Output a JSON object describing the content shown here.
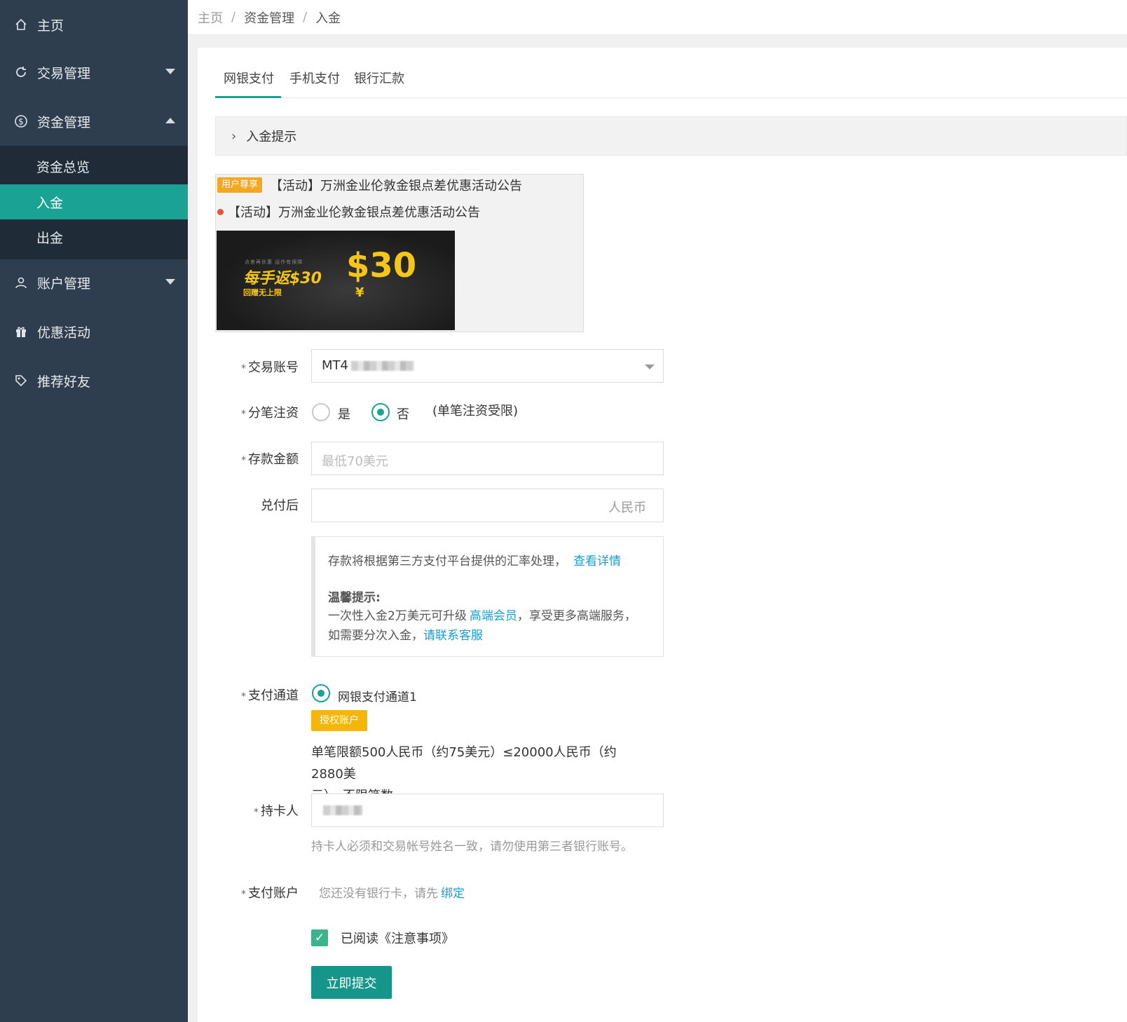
{
  "sidebar": {
    "items": [
      {
        "label": "主页",
        "icon": "home-icon"
      },
      {
        "label": "交易管理",
        "icon": "refresh-icon"
      },
      {
        "label": "资金管理",
        "icon": "dollar-icon"
      },
      {
        "label": "账户管理",
        "icon": "user-icon"
      },
      {
        "label": "优惠活动",
        "icon": "gift-icon"
      },
      {
        "label": "推荐好友",
        "icon": "tag-icon"
      }
    ],
    "submenu": [
      {
        "label": "资金总览"
      },
      {
        "label": "入金"
      },
      {
        "label": "出金"
      }
    ]
  },
  "breadcrumb": [
    "主页",
    "资金管理",
    "入金"
  ],
  "breadcrumb_sep": "/",
  "tabs": [
    {
      "label": "网银支付"
    },
    {
      "label": "手机支付"
    },
    {
      "label": "银行汇款"
    }
  ],
  "collapse": {
    "label": "入金提示"
  },
  "announcement": {
    "badge": "用户尊享",
    "line1": "【活动】万洲金业伦敦金银点差优惠活动公告",
    "line2": "【活动】万洲金业伦敦金银点差优惠活动公告",
    "banner": {
      "small": "点差再优惠 运作有保障",
      "main": "每手返$30",
      "sub": "回赠无上限",
      "big": "$30",
      "yen": "¥"
    }
  },
  "form": {
    "account": {
      "label": "交易账号",
      "required": "*",
      "value": "MT4"
    },
    "split": {
      "label": "分笔注资",
      "required": "*",
      "yes": "是",
      "no": "否",
      "note": "(单笔注资受限)",
      "selected": "否"
    },
    "amount": {
      "label": "存款金额",
      "required": "*",
      "placeholder": "最低70美元"
    },
    "converted": {
      "label": "兑付后",
      "suffix": "人民币"
    },
    "notice": {
      "line1": "存款将根据第三方支付平台提供的汇率处理，",
      "line1_link": "查看详情",
      "title": "温馨提示:",
      "line2": "一次性入金2万美元可升级",
      "line2_link": "高端会员",
      "line2_tail": "，享受更多高端服务，",
      "line3": "如需要分次入金，",
      "line3_link": "请联系客服"
    },
    "channel": {
      "label": "支付通道",
      "required": "*",
      "option": "网银支付通道1",
      "tag": "授权账户",
      "limit_line1": "单笔限额500人民币（约75美元）≤20000人民币（约2880美",
      "limit_line2": "元），不限笔数"
    },
    "holder": {
      "label": "持卡人",
      "required": "*",
      "hint": "持卡人必须和交易帐号姓名一致，请勿使用第三者银行账号。"
    },
    "pay_account": {
      "label": "支付账户",
      "required": "*",
      "text": "您还没有银行卡，请先",
      "link": "绑定"
    },
    "agree": {
      "label": "已阅读《注意事项》",
      "checked": true
    },
    "submit": "立即提交"
  },
  "colors": {
    "accent": "#1aa394",
    "sidebar": "#2e3e4e",
    "submenu": "#1f2b37",
    "link": "#1a9dcf",
    "badge": "#f5a623"
  }
}
